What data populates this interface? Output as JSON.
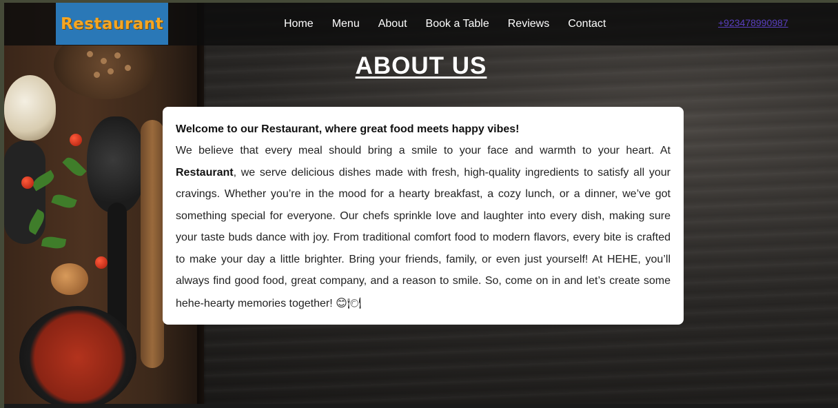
{
  "navbar": {
    "logo": "Restaurant",
    "links": [
      "Home",
      "Menu",
      "About",
      "Book a Table",
      "Reviews",
      "Contact"
    ],
    "phone": "+923478990987"
  },
  "about": {
    "title": "ABOUT US",
    "welcome": "Welcome to our Restaurant, where great food meets happy vibes!",
    "p_part1": "We believe that every meal should bring a smile to your face and warmth to your heart. At ",
    "brand": "Restaurant",
    "p_part2": ", we serve delicious dishes made with fresh, high-quality ingredients to satisfy all your cravings. Whether you’re in the mood for a hearty breakfast, a cozy lunch, or a dinner, we’ve got something special for everyone. Our chefs sprinkle love and laughter into every dish, making sure your taste buds dance with joy. From traditional comfort food to modern flavors, every bite is crafted to make your day a little brighter. Bring your friends, family, or even just yourself! At HEHE, you’ll always find good food, great company, and a reason to smile. So, come on in and let’s create some hehe-hearty memories together! ",
    "emojis": "😊🍽"
  },
  "colors": {
    "logo_bg": "#2a78b7",
    "logo_text": "#f5a623",
    "phone_link": "#5a3fc0",
    "card_bg": "#ffffff"
  }
}
